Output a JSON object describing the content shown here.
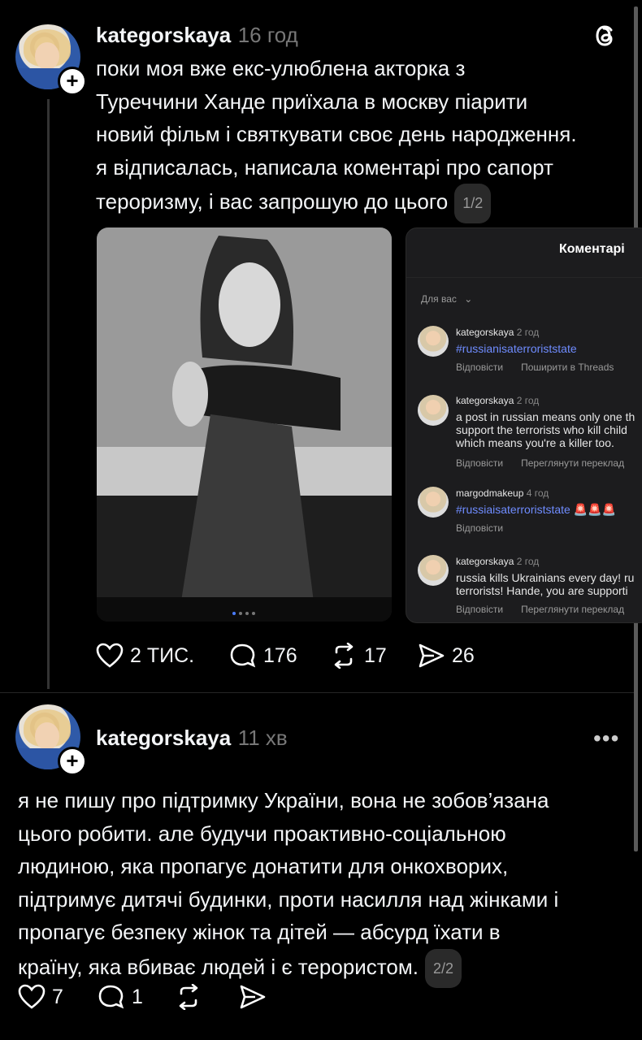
{
  "post1": {
    "username": "kategorskaya",
    "time": "16 год",
    "text_lines": [
      "поки моя вже екс-улюблена акторка з",
      "Туреччини Ханде приїхала в москву піарити",
      "новий фільм і святкувати своє день народження.",
      "я відписалась, написала коментарі про сапорт",
      "тероризму, і вас запрошую до цього"
    ],
    "pager": "1/2",
    "likes": "2 ТИС.",
    "comments": "176",
    "reposts": "17",
    "shares": "26"
  },
  "screenshot": {
    "title": "Коментарі",
    "filter": "Для вас",
    "comments": [
      {
        "user": "kategorskaya",
        "time": "2 год",
        "body": [
          "#russianisaterroriststate"
        ],
        "link": true,
        "actions": [
          "Відповісти",
          "Поширити в Threads"
        ]
      },
      {
        "user": "kategorskaya",
        "time": "2 год",
        "body": [
          "a post in russian means only one th",
          "support the terrorists who kill child",
          "which means you're a killer too."
        ],
        "link": false,
        "actions": [
          "Відповісти",
          "Переглянути переклад"
        ]
      },
      {
        "user": "margodmakeup",
        "time": "4 год",
        "body": [
          "#russiaisaterroriststate 🚨🚨🚨"
        ],
        "link": true,
        "actions": [
          "Відповісти"
        ]
      },
      {
        "user": "kategorskaya",
        "time": "2 год",
        "body": [
          "russia kills Ukrainians every day! ru",
          "terrorists! Hande, you are supporti"
        ],
        "link": false,
        "actions": [
          "Відповісти",
          "Переглянути переклад"
        ]
      }
    ]
  },
  "post2": {
    "username": "kategorskaya",
    "time": "11 хв",
    "text_lines": [
      "я не пишу про підтримку України, вона не зобов’язана",
      "цього робити. але будучи проактивно-соціальною",
      "людиною, яка пропагує донатити для онкохворих,",
      "підтримує дитячі будинки, проти насилля над жінками і",
      "пропагує безпеку жінок та дітей — абсурд їхати в",
      "країну, яка вбиває людей і є терористом."
    ],
    "pager": "2/2",
    "likes": "7",
    "comments": "1"
  },
  "icons": [
    "threads-logo-icon",
    "plus-icon",
    "heart-icon",
    "comment-icon",
    "repost-icon",
    "share-icon",
    "more-icon",
    "chevron-down-icon"
  ]
}
